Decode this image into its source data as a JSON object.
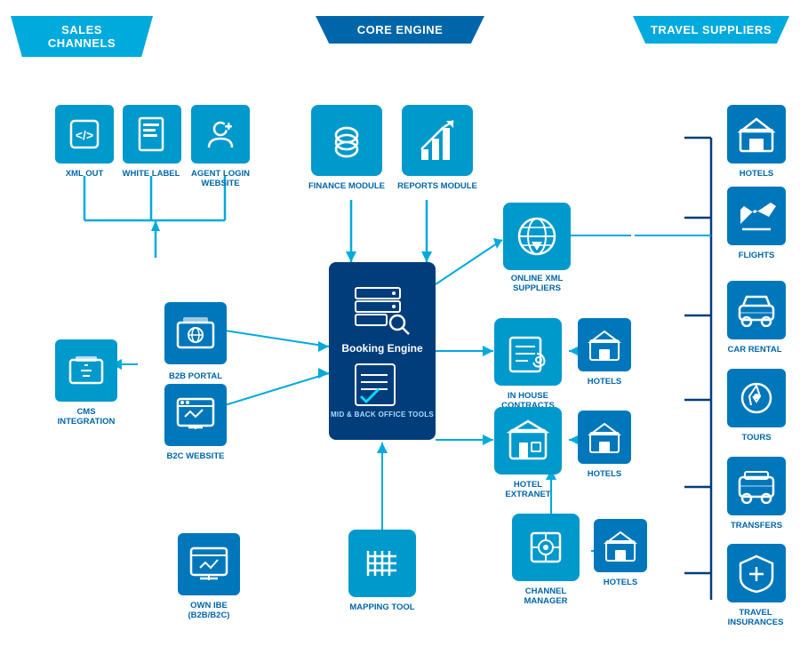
{
  "headers": {
    "sales": "SALES CHANNELS",
    "core": "CORE ENGINE",
    "suppliers": "TRAVEL SUPPLIERS"
  },
  "sales_channels": {
    "xml_out": "XML OUT",
    "white_label": "WHITE LABEL",
    "agent_login": "AGENT LOGIN WEBSITE",
    "b2b_portal": "B2B PORTAL",
    "b2c_website": "B2C WEBSITE",
    "cms_integration": "CMS INTEGRATION",
    "own_ibe": "OWN IBE (B2B/B2C)"
  },
  "core_engine": {
    "finance": "FINANCE MODULE",
    "reports": "REPORTS MODULE",
    "booking_engine": "Booking Engine",
    "mid_back": "MID & BACK OFFICE TOOLS",
    "mapping": "MAPPING TOOL"
  },
  "middle": {
    "online_xml": "ONLINE XML SUPPLIERS",
    "inhouse": "IN HOUSE CONTRACTS",
    "hotel_extranet": "HOTEL EXTRANET",
    "channel_manager": "CHANNEL MANAGER",
    "hotels1": "HOTELS",
    "hotels2": "HOTELS",
    "hotels3": "HOTELS"
  },
  "suppliers": {
    "hotels": "HOTELS",
    "flights": "FLIGHTS",
    "car_rental": "CAR RENTAL",
    "tours": "TOURS",
    "transfers": "TRANSFERS",
    "travel_insurances": "TRAVEL INSURANCES"
  }
}
